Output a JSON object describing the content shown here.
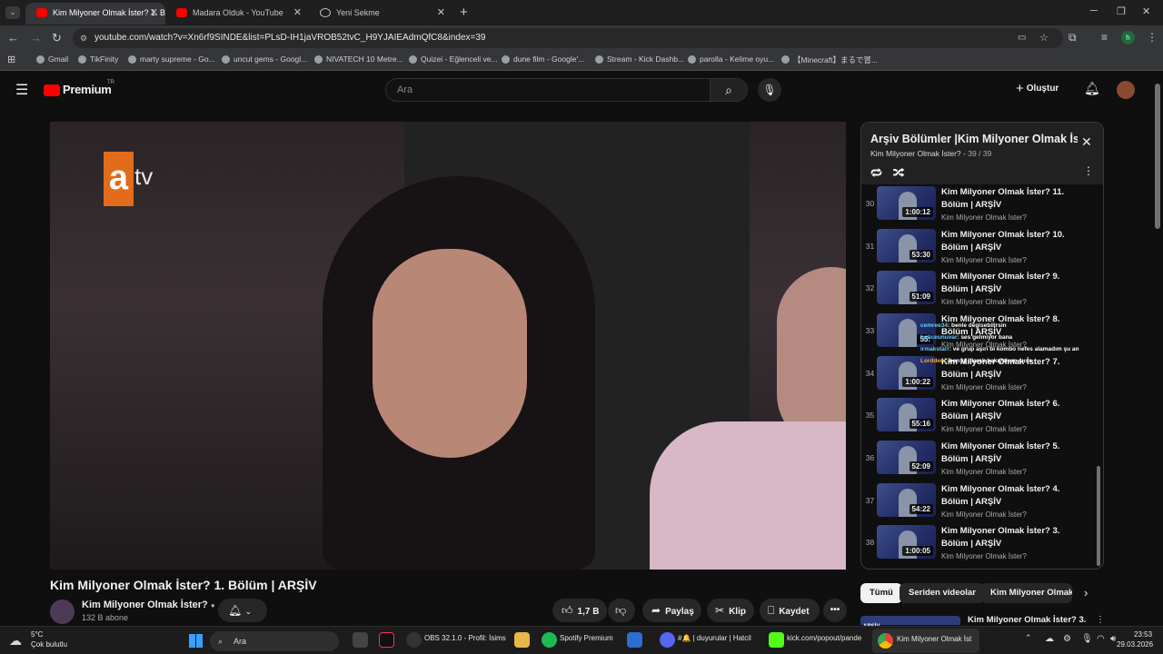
{
  "browser": {
    "tabs": [
      {
        "label": "Kim Milyoner Olmak İster? 1. B"
      },
      {
        "label": "Madara Olduk - YouTube"
      },
      {
        "label": "Yeni Sekme"
      }
    ],
    "url": "youtube.com/watch?v=Xn6rf9SINDE&list=PLsD-IH1jaVROB52tvC_H9YJAIEAdmQfC8&index=39",
    "bookmarks": [
      "Gmail",
      "TikFinity",
      "marty supreme - Go...",
      "uncut gems - Googl...",
      "NIVATECH 10 Metre...",
      "Quizei - Eğlenceli ve...",
      "dune film - Google'...",
      "Stream - Kick Dashb...",
      "parolla - Kelime oyu...",
      "【Minecraft】まるで冒..."
    ]
  },
  "yt": {
    "brand": "Premium",
    "brand_sup": "TR",
    "search_placeholder": "Ara",
    "create_label": "Oluştur"
  },
  "video": {
    "overlay_logo_a": "a",
    "overlay_logo_tv": "tv",
    "title": "Kim Milyoner Olmak İster? 1. Bölüm | ARŞİV",
    "channel": "Kim Milyoner Olmak İster?",
    "subscribers": "132 B abone",
    "likes": "1,7 B",
    "share_label": "Paylaş",
    "clip_label": "Klip",
    "save_label": "Kaydet"
  },
  "playlist": {
    "title": "Arşiv Bölümler |Kim Milyoner Olmak İster?",
    "channel": "Kim Milyoner Olmak İster?",
    "position": "39 / 39",
    "items": [
      {
        "num": "30",
        "title": "Kim Milyoner Olmak İster? 11. Bölüm | ARŞİV",
        "duration": "1:00:12",
        "channel": "Kim Milyoner Olmak İster?"
      },
      {
        "num": "31",
        "title": "Kim Milyoner Olmak İster? 10. Bölüm | ARŞİV",
        "duration": "53:30",
        "channel": "Kim Milyoner Olmak İster?"
      },
      {
        "num": "32",
        "title": "Kim Milyoner Olmak İster? 9. Bölüm | ARŞİV",
        "duration": "51:09",
        "channel": "Kim Milyoner Olmak İster?"
      },
      {
        "num": "33",
        "title": "Kim Milyoner Olmak İster? 8. Bölüm | ARŞİV",
        "duration": "55:",
        "channel": "Kim Milyoner Olmak İster?"
      },
      {
        "num": "34",
        "title": "Kim Milyoner Olmak İster? 7. Bölüm | ARŞİV",
        "duration": "1:00:22",
        "channel": "Kim Milyoner Olmak İster?"
      },
      {
        "num": "35",
        "title": "Kim Milyoner Olmak İster? 6. Bölüm | ARŞİV",
        "duration": "55:16",
        "channel": "Kim Milyoner Olmak İster?"
      },
      {
        "num": "36",
        "title": "Kim Milyoner Olmak İster? 5. Bölüm | ARŞİV",
        "duration": "52:09",
        "channel": "Kim Milyoner Olmak İster?"
      },
      {
        "num": "37",
        "title": "Kim Milyoner Olmak İster? 4. Bölüm | ARŞİV",
        "duration": "54:22",
        "channel": "Kim Milyoner Olmak İster?"
      },
      {
        "num": "38",
        "title": "Kim Milyoner Olmak İster? 3. Bölüm | ARŞİV",
        "duration": "1:00:05",
        "channel": "Kim Milyoner Olmak İster?"
      }
    ]
  },
  "chat": [
    {
      "user": "cemree34",
      "text": ": benle degisebilirsin"
    },
    {
      "user": "haticeunuvar",
      "text": ": ses gelmiyor bana"
    },
    {
      "user": "irmakstarr",
      "text": ": ve grup aşırı bi kombo nefes alamadım şu an"
    },
    {
      "user": "Lorddeni",
      "text": ": ben iş olarak bakıyorum suss"
    }
  ],
  "chips": [
    "Tümü",
    "Seriden videolar",
    "Kim Milyoner Olmak İster?"
  ],
  "next_title": "Kim Milyoner Olmak İster? 3.",
  "next_badge": "ARŞİV",
  "taskbar": {
    "weather_temp": "5°C",
    "weather_desc": "Çok bulutlu",
    "search": "Ara",
    "apps": [
      "OBS 32.1.0 - Profil: İsims",
      "Spotify Premium",
      "#🔔 | duyurular | Hatcil",
      "kick.com/popout/pande",
      "Kim Milyoner Olmak İst"
    ],
    "time": "23:53",
    "date": "29.03.2026"
  }
}
